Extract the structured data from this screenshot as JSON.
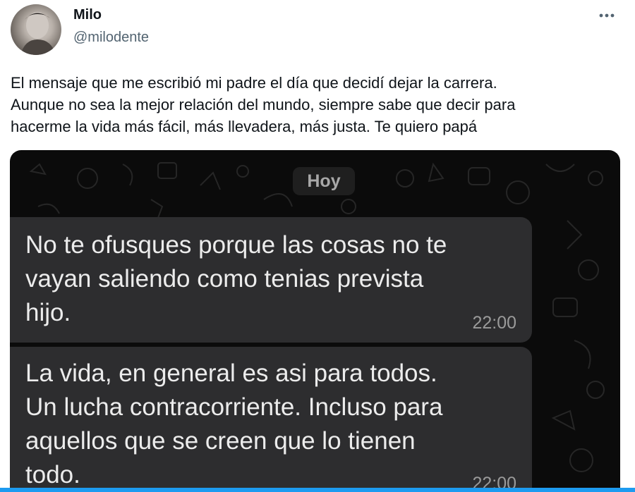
{
  "tweet": {
    "author": {
      "display_name": "Milo",
      "handle": "@milodente",
      "avatar_icon": "profile-photo"
    },
    "more_icon": "more-horizontal-icon",
    "text_lines": [
      "El mensaje que me escribió mi padre el día que decidí dejar la carrera.",
      "Aunque no sea la mejor relación del mundo, siempre sabe que decir para",
      "hacerme la vida más fácil, más llevadera, más justa. Te quiero papá"
    ]
  },
  "chat_screenshot": {
    "date_label": "Hoy",
    "messages": [
      {
        "lines": [
          "No te ofusques porque las cosas no te",
          "vayan saliendo como tenias prevista",
          "hijo."
        ],
        "time": "22:00"
      },
      {
        "lines": [
          "La vida, en general es asi para todos.",
          "Un lucha contracorriente. Incluso para",
          "aquellos que se creen que lo tienen",
          "todo."
        ],
        "time": "22:00"
      }
    ]
  },
  "colors": {
    "text_primary": "#0f1419",
    "text_secondary": "#536471",
    "chat_background": "#0b0b0b",
    "bubble": "#2d2d2f",
    "bubble_text": "#ececec",
    "accent": "#1d9bf0"
  }
}
